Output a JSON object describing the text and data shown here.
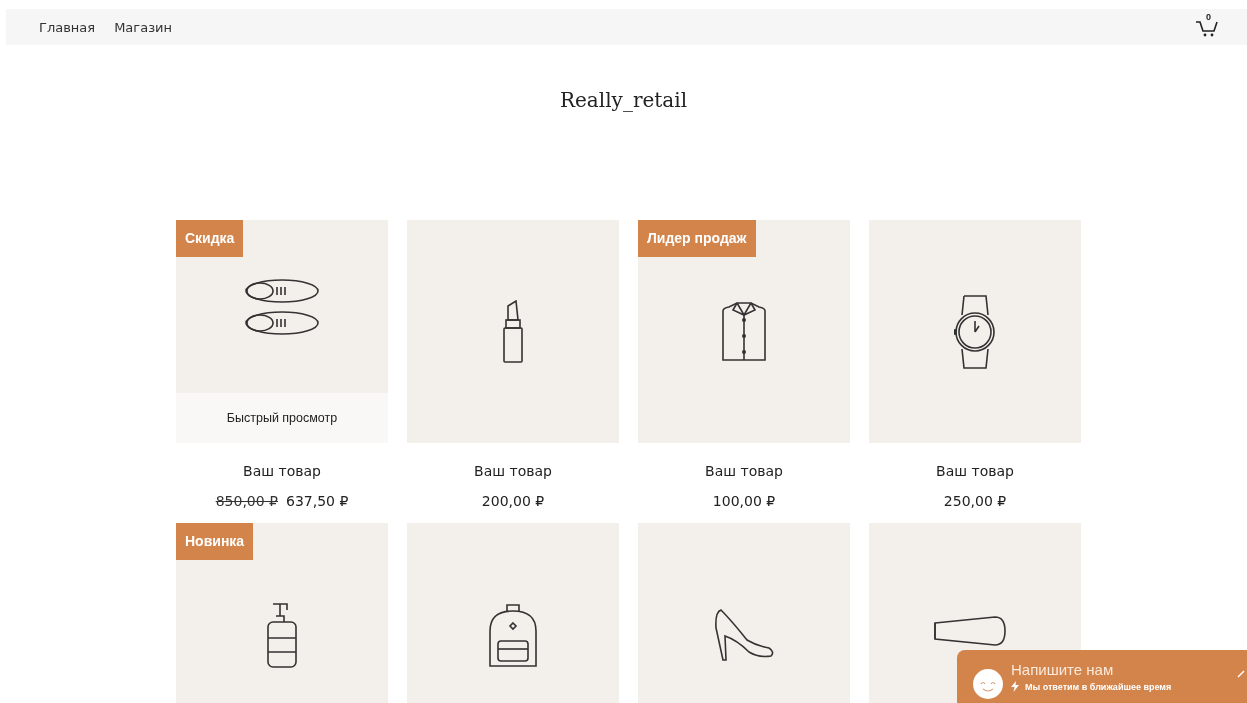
{
  "nav": {
    "links": [
      "Главная",
      "Магазин"
    ],
    "cart_count": "0"
  },
  "site_title": "Really_retail",
  "products": [
    {
      "kind": "shoes",
      "badge": "Скидка",
      "quick_view": "Быстрый просмотр",
      "name": "Ваш товар",
      "old_price": "850,00 ₽",
      "price": "637,50 ₽"
    },
    {
      "kind": "lipstick",
      "name": "Ваш товар",
      "price": "200,00 ₽"
    },
    {
      "kind": "shirt",
      "badge": "Лидер продаж",
      "name": "Ваш товар",
      "price": "100,00 ₽"
    },
    {
      "kind": "watch",
      "name": "Ваш товар",
      "price": "250,00 ₽"
    },
    {
      "kind": "soap",
      "badge": "Новинка"
    },
    {
      "kind": "backpack"
    },
    {
      "kind": "heel"
    },
    {
      "kind": "hairdryer"
    }
  ],
  "chat": {
    "title": "Напишите нам",
    "subtitle": "Мы ответим в ближайшее время"
  }
}
